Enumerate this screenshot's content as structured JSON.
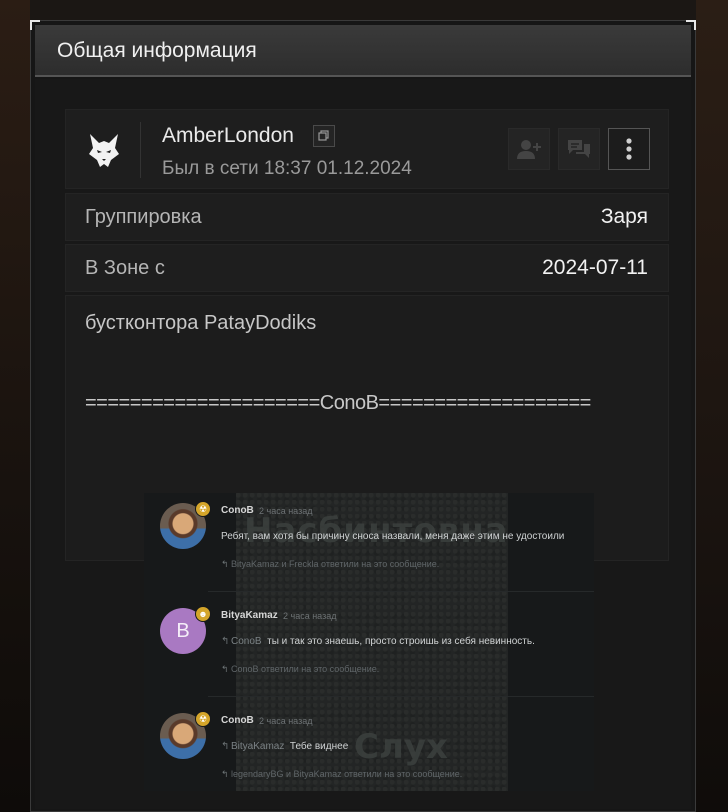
{
  "header": {
    "title": "Общая информация"
  },
  "profile": {
    "username": "AmberLondon",
    "status": "Был в сети 18:37 01.12.2024",
    "icons": {
      "avatar": "wolf-head-icon",
      "copy": "copy-icon",
      "add_friend": "add-friend-icon",
      "message": "chat-bubbles-icon",
      "more": "more-vertical-icon"
    }
  },
  "info_rows": [
    {
      "label": "Группировка",
      "value": "Заря"
    },
    {
      "label": "В Зоне с",
      "value": "2024-07-11"
    }
  ],
  "about": {
    "line1": "бустконтора PatayDodiks",
    "line2": "=====================ConoB==================="
  },
  "screenshot": {
    "background_words": [
      "Насбинтовна",
      "Слух"
    ],
    "comments": [
      {
        "author": "ConoB",
        "time": "2 часа назад",
        "reply_to": "",
        "text": "Ребят, вам хотя бы причину сноса назвали, меня даже этим не удостоили",
        "replies": "BityaKamaz и Freckla ответили на это сообщение."
      },
      {
        "author": "BityaKamaz",
        "avatar_letter": "B",
        "time": "2 часа назад",
        "reply_to": "ConoB",
        "text": "ты и так это знаешь, просто строишь из себя невинность.",
        "replies": "ConoB ответили на это сообщение."
      },
      {
        "author": "ConoB",
        "time": "2 часа назад",
        "reply_to": "BityaKamaz",
        "text": "Тебе виднее",
        "replies": "legendaryBG и BityaKamaz ответили на это сообщение."
      }
    ]
  }
}
